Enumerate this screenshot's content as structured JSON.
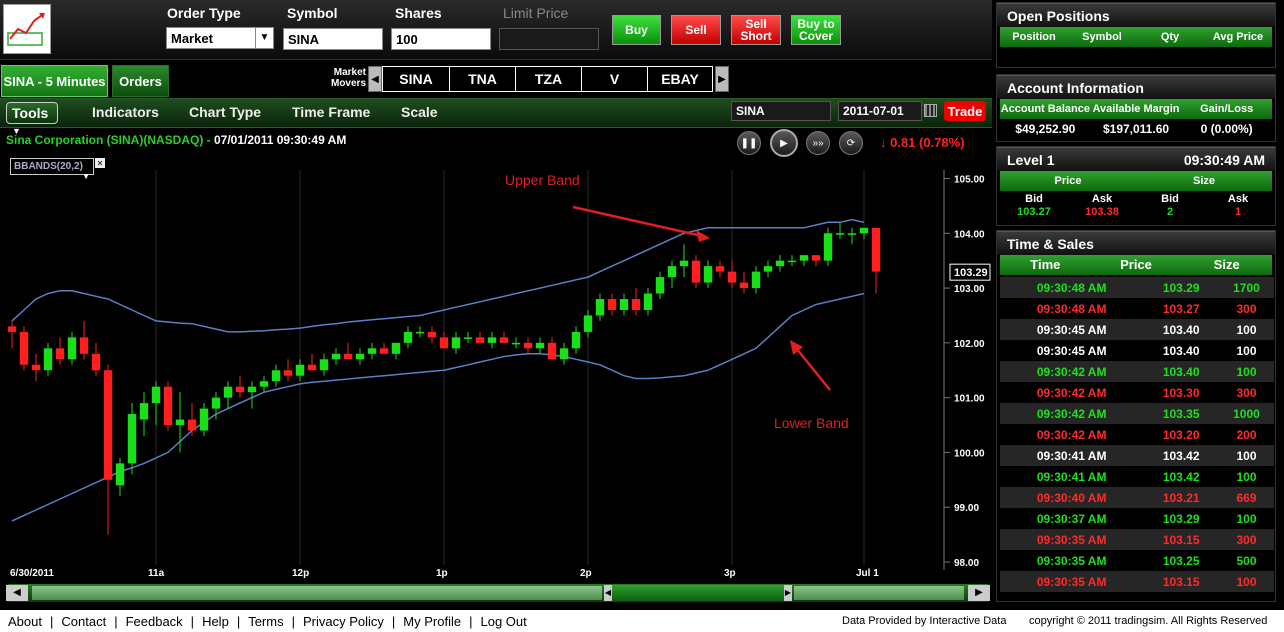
{
  "order": {
    "type_label": "Order Type",
    "type_value": "Market",
    "symbol_label": "Symbol",
    "symbol_value": "SINA",
    "shares_label": "Shares",
    "shares_value": "100",
    "limit_label": "Limit Price",
    "limit_value": "",
    "buy": "Buy",
    "sell": "Sell",
    "sell_short": "Sell Short",
    "buy_cover": "Buy to Cover"
  },
  "tabs": [
    {
      "label": "SINA - 5 Minutes"
    },
    {
      "label": "Orders"
    }
  ],
  "movers": {
    "label": "Market Movers",
    "symbols": [
      "SINA",
      "TNA",
      "TZA",
      "V",
      "EBAY"
    ]
  },
  "toolbar": {
    "tools": "Tools",
    "indicators": "Indicators",
    "chart_type": "Chart Type",
    "time_frame": "Time Frame",
    "scale": "Scale",
    "symbol_field": "SINA",
    "date_field": "2011-07-01",
    "trade": "Trade"
  },
  "chart_header": {
    "name": "Sina Corporation  (SINA)(NASDAQ)  -",
    "datetime": "07/01/2011 09:30:49 AM",
    "change": "↓ 0.81 (0.78%)",
    "indicator": "BBANDS(20,2)"
  },
  "chart_data": {
    "type": "candlestick",
    "y_ticks": [
      "105.00",
      "104.00",
      "103.00",
      "102.00",
      "101.00",
      "100.00",
      "99.00",
      "98.00"
    ],
    "ylim": [
      98,
      105.1
    ],
    "x_ticks": [
      {
        "i": 0,
        "label": "6/30/2011"
      },
      {
        "i": 12,
        "label": "11a"
      },
      {
        "i": 24,
        "label": "12p"
      },
      {
        "i": 36,
        "label": "1p"
      },
      {
        "i": 48,
        "label": "2p"
      },
      {
        "i": 60,
        "label": "3p"
      },
      {
        "i": 71,
        "label": "Jul 1"
      }
    ],
    "last_price_label": "103.29",
    "annotations": [
      {
        "text": "Upper Band"
      },
      {
        "text": "Lower Band"
      }
    ],
    "candles": [
      [
        102.3,
        102.4,
        101.9,
        102.2
      ],
      [
        102.2,
        102.3,
        101.5,
        101.6
      ],
      [
        101.6,
        101.8,
        101.3,
        101.5
      ],
      [
        101.5,
        102.0,
        101.4,
        101.9
      ],
      [
        101.9,
        102.1,
        101.6,
        101.7
      ],
      [
        101.7,
        102.2,
        101.6,
        102.1
      ],
      [
        102.1,
        102.4,
        101.7,
        101.8
      ],
      [
        101.8,
        102.0,
        101.4,
        101.5
      ],
      [
        101.5,
        101.6,
        98.5,
        99.5
      ],
      [
        99.4,
        99.9,
        99.2,
        99.8
      ],
      [
        99.8,
        100.9,
        99.6,
        100.7
      ],
      [
        100.6,
        101.1,
        100.3,
        100.9
      ],
      [
        100.9,
        101.3,
        100.5,
        101.2
      ],
      [
        101.2,
        101.3,
        100.4,
        100.5
      ],
      [
        100.5,
        101.1,
        100.0,
        100.6
      ],
      [
        100.6,
        100.9,
        100.3,
        100.4
      ],
      [
        100.4,
        100.9,
        100.3,
        100.8
      ],
      [
        100.8,
        101.1,
        100.6,
        101.0
      ],
      [
        101.0,
        101.3,
        100.8,
        101.2
      ],
      [
        101.2,
        101.4,
        101.0,
        101.1
      ],
      [
        101.1,
        101.3,
        100.8,
        101.2
      ],
      [
        101.2,
        101.4,
        101.1,
        101.3
      ],
      [
        101.3,
        101.6,
        101.2,
        101.5
      ],
      [
        101.5,
        101.7,
        101.3,
        101.4
      ],
      [
        101.4,
        101.7,
        101.3,
        101.6
      ],
      [
        101.6,
        101.8,
        101.5,
        101.5
      ],
      [
        101.5,
        101.8,
        101.4,
        101.7
      ],
      [
        101.7,
        101.9,
        101.6,
        101.8
      ],
      [
        101.8,
        102.0,
        101.7,
        101.7
      ],
      [
        101.7,
        101.9,
        101.6,
        101.8
      ],
      [
        101.8,
        102.0,
        101.7,
        101.9
      ],
      [
        101.9,
        102.0,
        101.8,
        101.8
      ],
      [
        101.8,
        102.0,
        101.7,
        102.0
      ],
      [
        102.0,
        102.3,
        101.9,
        102.2
      ],
      [
        102.2,
        102.3,
        102.1,
        102.2
      ],
      [
        102.2,
        102.3,
        102.0,
        102.1
      ],
      [
        102.1,
        102.2,
        101.9,
        101.9
      ],
      [
        101.9,
        102.2,
        101.8,
        102.1
      ],
      [
        102.1,
        102.2,
        102.0,
        102.1
      ],
      [
        102.1,
        102.2,
        102.0,
        102.0
      ],
      [
        102.0,
        102.2,
        101.9,
        102.1
      ],
      [
        102.1,
        102.2,
        102.0,
        102.0
      ],
      [
        102.0,
        102.1,
        101.9,
        102.0
      ],
      [
        102.0,
        102.1,
        101.8,
        101.9
      ],
      [
        101.9,
        102.1,
        101.8,
        102.0
      ],
      [
        102.0,
        102.1,
        101.7,
        101.7
      ],
      [
        101.7,
        102.0,
        101.6,
        101.9
      ],
      [
        101.9,
        102.3,
        101.8,
        102.2
      ],
      [
        102.2,
        102.6,
        102.1,
        102.5
      ],
      [
        102.5,
        102.9,
        102.4,
        102.8
      ],
      [
        102.8,
        102.9,
        102.5,
        102.6
      ],
      [
        102.6,
        102.9,
        102.5,
        102.8
      ],
      [
        102.8,
        103.0,
        102.5,
        102.6
      ],
      [
        102.6,
        103.0,
        102.5,
        102.9
      ],
      [
        102.9,
        103.3,
        102.8,
        103.2
      ],
      [
        103.2,
        103.5,
        103.0,
        103.4
      ],
      [
        103.4,
        103.8,
        103.2,
        103.5
      ],
      [
        103.5,
        103.6,
        103.0,
        103.1
      ],
      [
        103.1,
        103.5,
        103.0,
        103.4
      ],
      [
        103.4,
        103.5,
        103.2,
        103.3
      ],
      [
        103.3,
        103.5,
        103.0,
        103.1
      ],
      [
        103.1,
        103.3,
        102.9,
        103.0
      ],
      [
        103.0,
        103.4,
        102.9,
        103.3
      ],
      [
        103.3,
        103.5,
        103.2,
        103.4
      ],
      [
        103.4,
        103.6,
        103.3,
        103.5
      ],
      [
        103.5,
        103.6,
        103.4,
        103.5
      ],
      [
        103.5,
        103.6,
        103.4,
        103.6
      ],
      [
        103.6,
        103.6,
        103.4,
        103.5
      ],
      [
        103.5,
        104.1,
        103.4,
        104.0
      ],
      [
        104.0,
        104.2,
        103.9,
        104.0
      ],
      [
        104.0,
        104.1,
        103.8,
        104.0
      ],
      [
        104.0,
        104.1,
        103.9,
        104.1
      ],
      [
        104.1,
        103.8,
        102.9,
        103.3
      ]
    ],
    "upper_band": [
      102.4,
      102.6,
      102.8,
      102.9,
      102.95,
      102.95,
      102.9,
      102.85,
      102.8,
      102.7,
      102.6,
      102.5,
      102.4,
      102.38,
      102.36,
      102.35,
      102.3,
      102.25,
      102.2,
      102.2,
      102.21,
      102.22,
      102.24,
      102.25,
      102.27,
      102.3,
      102.33,
      102.35,
      102.38,
      102.4,
      102.42,
      102.44,
      102.46,
      102.48,
      102.5,
      102.55,
      102.6,
      102.65,
      102.7,
      102.75,
      102.8,
      102.85,
      102.9,
      102.95,
      103.0,
      103.05,
      103.1,
      103.15,
      103.2,
      103.3,
      103.4,
      103.5,
      103.6,
      103.7,
      103.8,
      103.9,
      104.0,
      104.05,
      104.1,
      104.1,
      104.1,
      104.1,
      104.1,
      104.1,
      104.1,
      104.1,
      104.1,
      104.15,
      104.2,
      104.2,
      104.25,
      104.2
    ],
    "lower_band": [
      98.75,
      98.85,
      98.95,
      99.05,
      99.15,
      99.25,
      99.35,
      99.45,
      99.55,
      99.65,
      99.72,
      99.8,
      99.9,
      100.0,
      100.2,
      100.4,
      100.55,
      100.7,
      100.8,
      100.9,
      101.0,
      101.1,
      101.15,
      101.2,
      101.25,
      101.28,
      101.3,
      101.32,
      101.34,
      101.36,
      101.38,
      101.4,
      101.42,
      101.44,
      101.46,
      101.48,
      101.5,
      101.55,
      101.6,
      101.65,
      101.7,
      101.75,
      101.78,
      101.8,
      101.8,
      101.78,
      101.75,
      101.7,
      101.65,
      101.6,
      101.5,
      101.4,
      101.35,
      101.35,
      101.36,
      101.38,
      101.4,
      101.45,
      101.5,
      101.6,
      101.7,
      101.8,
      101.9,
      102.1,
      102.3,
      102.5,
      102.6,
      102.7,
      102.75,
      102.8,
      102.85,
      102.9
    ]
  },
  "open_positions": {
    "title": "Open Positions",
    "cols": [
      "Position",
      "Symbol",
      "Qty",
      "Avg Price"
    ]
  },
  "account": {
    "title": "Account Information",
    "cols": [
      "Account Balance",
      "Available Margin",
      "Gain/Loss"
    ],
    "values": [
      "$49,252.90",
      "$197,011.60",
      "0 (0.00%)"
    ]
  },
  "level1": {
    "title": "Level 1",
    "time": "09:30:49 AM",
    "groups": [
      "Price",
      "Size"
    ],
    "cols": [
      "Bid",
      "Ask",
      "Bid",
      "Ask"
    ],
    "values": [
      "103.27",
      "103.38",
      "2",
      "1"
    ]
  },
  "time_sales": {
    "title": "Time & Sales",
    "cols": [
      "Time",
      "Price",
      "Size"
    ],
    "rows": [
      [
        "09:30:48 AM",
        "103.29",
        "1700",
        "g"
      ],
      [
        "09:30:48 AM",
        "103.27",
        "300",
        "r"
      ],
      [
        "09:30:45 AM",
        "103.40",
        "100",
        "w"
      ],
      [
        "09:30:45 AM",
        "103.40",
        "100",
        "w"
      ],
      [
        "09:30:42 AM",
        "103.40",
        "100",
        "g"
      ],
      [
        "09:30:42 AM",
        "103.30",
        "300",
        "r"
      ],
      [
        "09:30:42 AM",
        "103.35",
        "1000",
        "g"
      ],
      [
        "09:30:42 AM",
        "103.20",
        "200",
        "r"
      ],
      [
        "09:30:41 AM",
        "103.42",
        "100",
        "w"
      ],
      [
        "09:30:41 AM",
        "103.42",
        "100",
        "g"
      ],
      [
        "09:30:40 AM",
        "103.21",
        "669",
        "r"
      ],
      [
        "09:30:37 AM",
        "103.29",
        "100",
        "g"
      ],
      [
        "09:30:35 AM",
        "103.15",
        "300",
        "r"
      ],
      [
        "09:30:35 AM",
        "103.25",
        "500",
        "g"
      ],
      [
        "09:30:35 AM",
        "103.15",
        "100",
        "r"
      ]
    ]
  },
  "footer": {
    "links": [
      "About",
      "Contact",
      "Feedback",
      "Help",
      "Terms",
      "Privacy Policy",
      "My Profile",
      "Log Out"
    ],
    "data_provided": "Data Provided by Interactive Data",
    "copyright": "copyright © 2011 tradingsim. All Rights Reserved"
  },
  "colors": {
    "up": "#19e019",
    "down": "#ff1f1f",
    "band": "#5a80c8",
    "annotation": "#e02020"
  }
}
